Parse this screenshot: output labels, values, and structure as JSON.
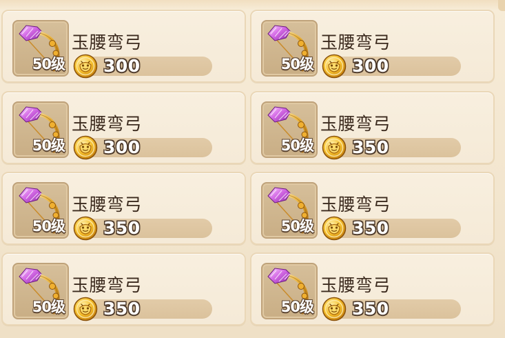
{
  "items": [
    {
      "name": "玉腰弯弓",
      "level": "50级",
      "price": "300"
    },
    {
      "name": "玉腰弯弓",
      "level": "50级",
      "price": "300"
    },
    {
      "name": "玉腰弯弓",
      "level": "50级",
      "price": "300"
    },
    {
      "name": "玉腰弯弓",
      "level": "50级",
      "price": "350"
    },
    {
      "name": "玉腰弯弓",
      "level": "50级",
      "price": "350"
    },
    {
      "name": "玉腰弯弓",
      "level": "50级",
      "price": "350"
    },
    {
      "name": "玉腰弯弓",
      "level": "50级",
      "price": "350"
    },
    {
      "name": "玉腰弯弓",
      "level": "50级",
      "price": "350"
    }
  ],
  "icons": {
    "item": "jade-bow-icon",
    "currency": "gold-coin-icon"
  },
  "colors": {
    "panel_bg": "#f3e6cf",
    "card_bg": "#f7eddc",
    "price_bar": "#dec6a1",
    "text_dark": "#3b2a1e",
    "coin_gold": "#f2b72a"
  }
}
